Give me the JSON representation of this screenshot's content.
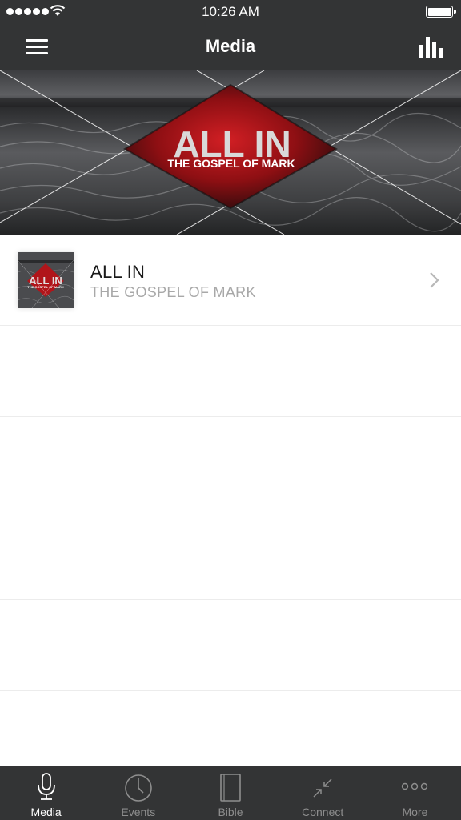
{
  "status_bar": {
    "time": "10:26 AM"
  },
  "nav": {
    "title": "Media"
  },
  "hero": {
    "title": "ALL IN",
    "subtitle": "THE GOSPEL OF MARK"
  },
  "list": {
    "items": [
      {
        "title": "ALL IN",
        "subtitle": "THE GOSPEL OF MARK",
        "thumb_title": "ALL IN",
        "thumb_subtitle": "THE GOSPEL OF MARK"
      }
    ]
  },
  "tabs": [
    {
      "label": "Media",
      "icon": "microphone-icon",
      "active": true
    },
    {
      "label": "Events",
      "icon": "clock-icon",
      "active": false
    },
    {
      "label": "Bible",
      "icon": "book-icon",
      "active": false
    },
    {
      "label": "Connect",
      "icon": "connect-arrows-icon",
      "active": false
    },
    {
      "label": "More",
      "icon": "more-dots-icon",
      "active": false
    }
  ],
  "colors": {
    "bar_background": "#333435",
    "accent_red": "#c4161c",
    "inactive_tab": "#8e8e8e",
    "subtitle_gray": "#a8a8a8"
  }
}
